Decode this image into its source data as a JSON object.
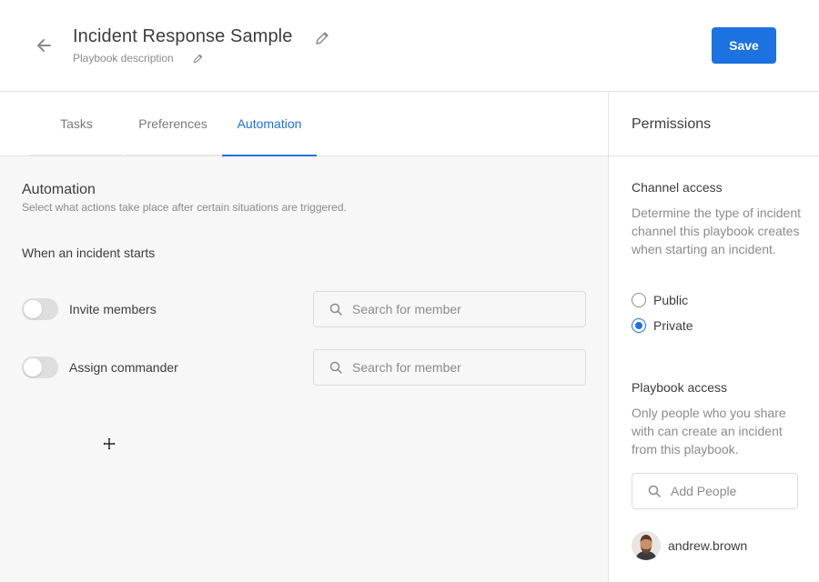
{
  "header": {
    "title": "Incident Response Sample",
    "description": "Playbook description",
    "save_label": "Save"
  },
  "tabs": [
    {
      "label": "Tasks",
      "active": false
    },
    {
      "label": "Preferences",
      "active": false
    },
    {
      "label": "Automation",
      "active": true
    }
  ],
  "automation": {
    "title": "Automation",
    "subtitle": "Select what actions take place after certain situations are triggered.",
    "trigger_label": "When an incident starts",
    "rows": [
      {
        "label": "Invite members",
        "enabled": false,
        "placeholder": "Search for member"
      },
      {
        "label": "Assign commander",
        "enabled": false,
        "placeholder": "Search for member"
      }
    ]
  },
  "permissions": {
    "title": "Permissions",
    "channel_access": {
      "label": "Channel access",
      "description": "Determine the type of incident channel this playbook creates when starting an incident.",
      "options": [
        {
          "label": "Public",
          "selected": false
        },
        {
          "label": "Private",
          "selected": true
        }
      ]
    },
    "playbook_access": {
      "label": "Playbook access",
      "description": "Only people who you share with can create an incident from this playbook.",
      "add_placeholder": "Add People",
      "members": [
        {
          "username": "andrew.brown"
        }
      ]
    }
  },
  "icons": {
    "back": "arrow-left-icon",
    "edit": "pencil-icon",
    "search": "magnifier-icon",
    "cursor": "move-cursor-icon"
  },
  "colors": {
    "accent": "#1c72e1",
    "text": "#3d3c40",
    "muted": "#8b8a8f",
    "panel": "#f7f7f8"
  }
}
